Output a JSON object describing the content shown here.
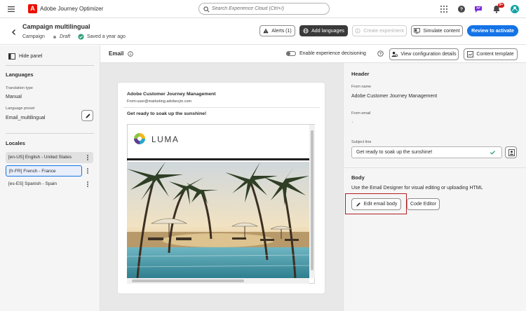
{
  "topbar": {
    "app_title": "Adobe Journey Optimizer",
    "logo_letter": "A",
    "search_placeholder": "Search Experience Cloud (Ctrl+/)",
    "notification_count": "9+",
    "icons": [
      "menu-icon",
      "apps-grid-icon",
      "help-icon",
      "feedback-icon",
      "bell-icon",
      "user-avatar-icon"
    ]
  },
  "header": {
    "title": "Campaign multilingual",
    "type": "Campaign",
    "status": "Draft",
    "saved": "Saved a year ago",
    "buttons": {
      "alerts": "Alerts (1)",
      "add_languages": "Add languages",
      "create_experiment": "Create experiment",
      "simulate": "Simulate content",
      "review": "Review to activate"
    }
  },
  "left_panel": {
    "hide_panel": "Hide panel",
    "languages_heading": "Languages",
    "translation_type_label": "Translation type",
    "translation_type_value": "Manual",
    "language_preset_label": "Language preset",
    "language_preset_value": "Email_multilingual",
    "locales_heading": "Locales",
    "locales": [
      {
        "label": "[en-US] English - United States",
        "state": "hover"
      },
      {
        "label": "[fr-FR] French - France",
        "state": "selected"
      },
      {
        "label": "[es-ES] Spanish - Spain",
        "state": "normal"
      }
    ]
  },
  "content_header": {
    "channel": "Email",
    "experience_decisioning": "Enable experience decisioning",
    "view_config": "View configuration details",
    "content_template": "Content template"
  },
  "email_preview": {
    "from_name": "Adobe Customer Journey Management",
    "from_address": "From:user@marketing.adobecjm.com",
    "subject": "Get ready to soak up the sunshine!",
    "brand": "LUMA"
  },
  "right_panel": {
    "header_heading": "Header",
    "from_name_label": "From name",
    "from_name_value": "Adobe Customer Journey Management",
    "from_email_label": "From email",
    "from_email_value": "ˈ",
    "subject_label": "Subject line",
    "subject_value": "Get ready to soak up the sunshine!",
    "body_heading": "Body",
    "body_description": "Use the Email Designer for visual editing or uploading HTML",
    "edit_body": "Edit email body",
    "code_editor": "Code Editor"
  },
  "colors": {
    "accent": "#1473e6",
    "brand_red": "#eb1000",
    "highlight_border": "#b31e24",
    "saved_green": "#2d9d78"
  }
}
